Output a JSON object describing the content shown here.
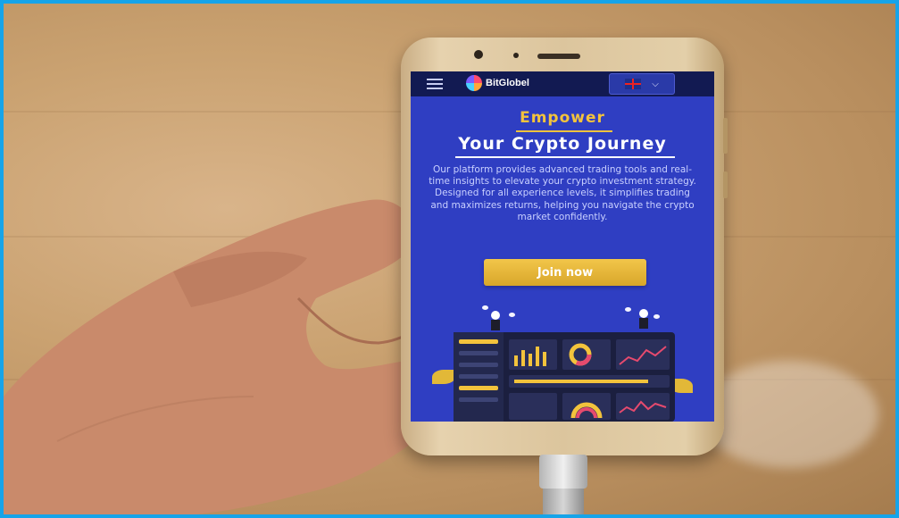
{
  "photo": {
    "subject": "hand-holding-phone",
    "frame_color": "#16a4e9"
  },
  "screen": {
    "brand": "BitGlobel",
    "language_flag": "uk-flag",
    "heading_line1": "Empower",
    "heading_line2": "Your Crypto Journey",
    "description": "Our platform provides advanced trading tools and real-time insights to elevate your crypto investment strategy. Designed for all experience levels, it simplifies trading and maximizes returns, helping you navigate the crypto market confidently.",
    "cta_label": "Join now",
    "colors": {
      "background": "#2f3ec2",
      "topbar": "#121a52",
      "accent": "#f3c33c"
    }
  }
}
